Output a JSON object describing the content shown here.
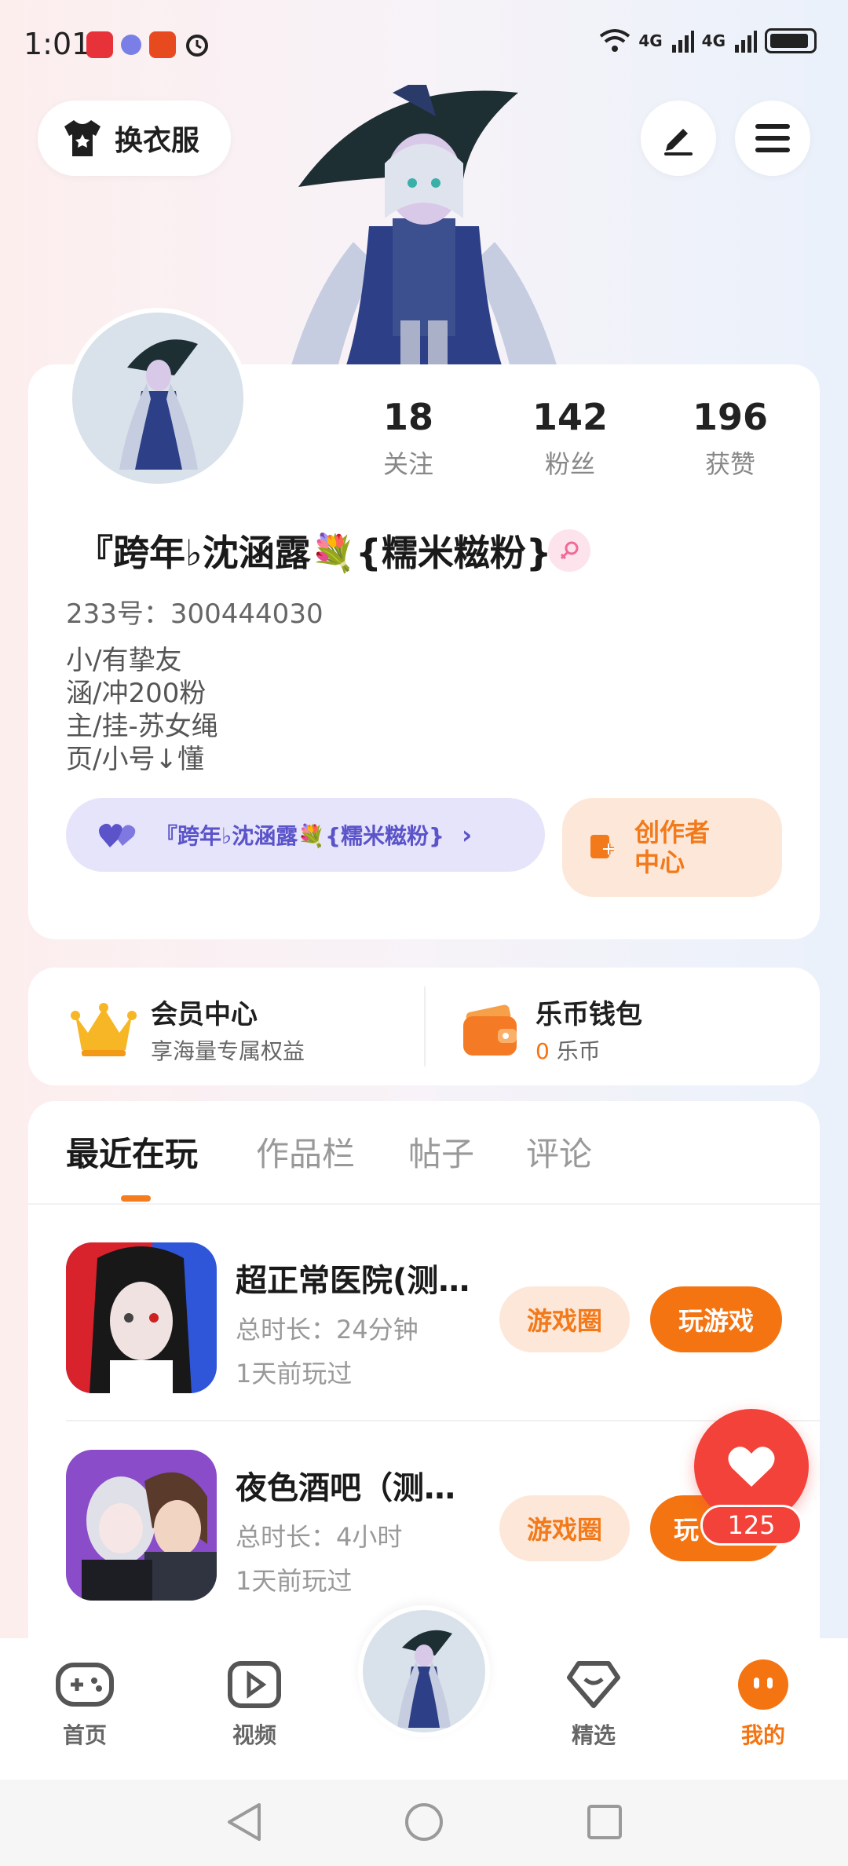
{
  "status_bar": {
    "time": "1:01",
    "signal1": "4G",
    "signal2": "4G"
  },
  "top": {
    "outfit_label": "换衣服"
  },
  "profile": {
    "stats": [
      {
        "value": "18",
        "label": "关注"
      },
      {
        "value": "142",
        "label": "粉丝"
      },
      {
        "value": "196",
        "label": "获赞"
      }
    ],
    "nickname": "『跨年♭沈涵露💐{糯米糍粉}",
    "user_id": "233号：300444030",
    "bio_lines": [
      "小/有挚友",
      "涵/冲200粉",
      "主/挂-苏女绳",
      "页/小号↓懂"
    ],
    "bind_pill_text": "『跨年♭沈涵露💐{糯米糍粉}",
    "creator_label_1": "创作者",
    "creator_label_2": "中心"
  },
  "member": {
    "vip_title": "会员中心",
    "vip_sub": "享海量专属权益",
    "wallet_title": "乐币钱包",
    "wallet_amount": "0",
    "wallet_unit": "乐币"
  },
  "tabs": [
    "最近在玩",
    "作品栏",
    "帖子",
    "评论"
  ],
  "games": [
    {
      "name": "超正常医院(测…",
      "duration": "总时长：24分钟",
      "last_played": "1天前玩过",
      "circle_btn": "游戏圈",
      "play_btn": "玩游戏"
    },
    {
      "name": "夜色酒吧（测…",
      "duration": "总时长：4小时",
      "last_played": "1天前玩过",
      "circle_btn": "游戏圈",
      "play_btn": "玩"
    }
  ],
  "like_fab": {
    "count": "125"
  },
  "bottom_nav": [
    {
      "label": "首页"
    },
    {
      "label": "视频"
    },
    {
      "label": "精选"
    },
    {
      "label": "我的"
    }
  ],
  "colors": {
    "accent": "#f57412",
    "like": "#f2423a",
    "purple": "#5b53c9"
  }
}
